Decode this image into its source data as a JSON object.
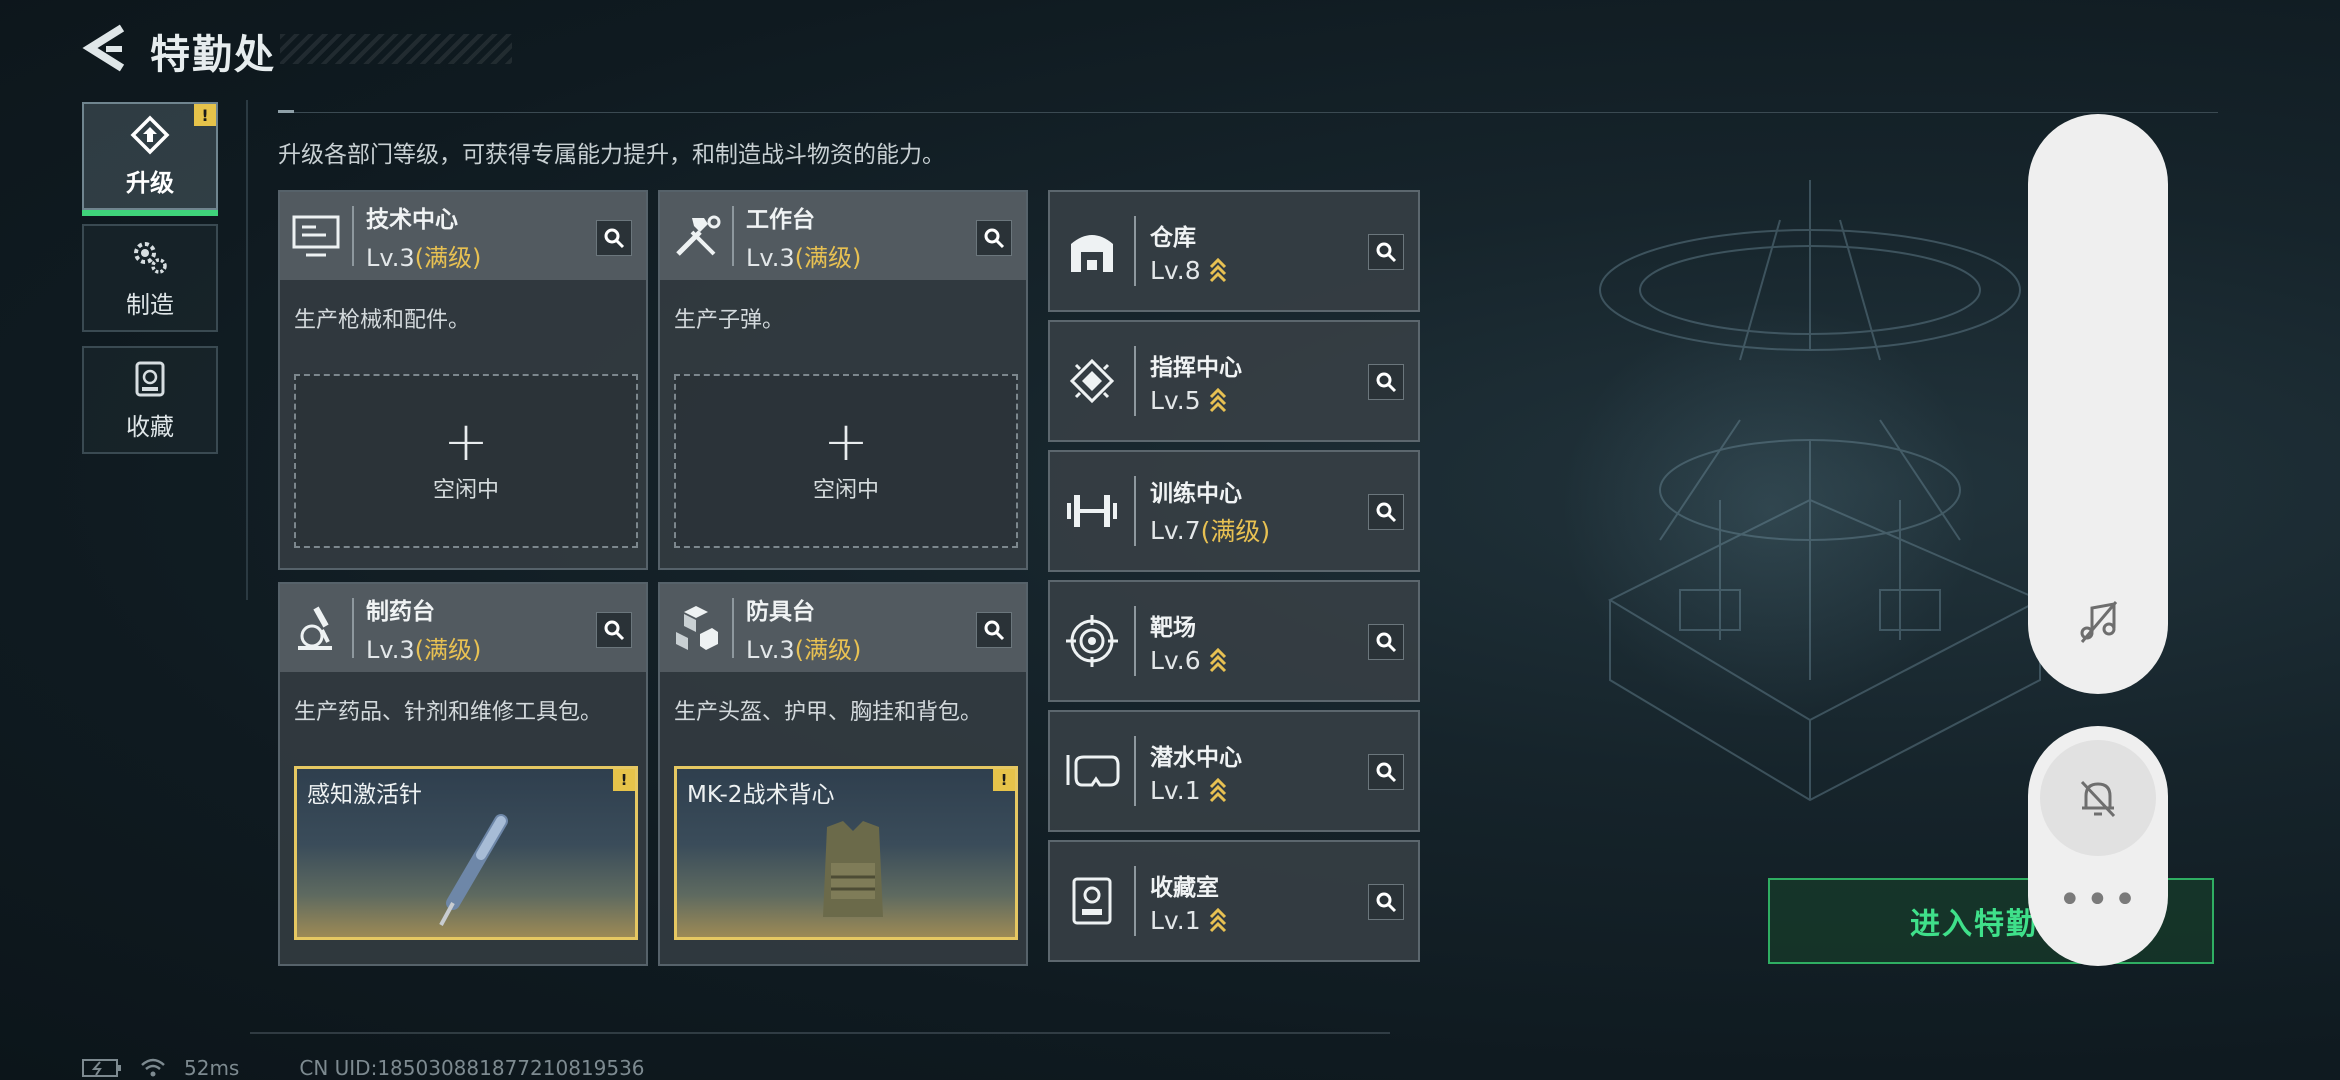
{
  "header": {
    "title": "特勤处"
  },
  "nav": [
    {
      "label": "升级",
      "icon": "upgrade-icon",
      "active": true,
      "badge": "!"
    },
    {
      "label": "制造",
      "icon": "gears-icon",
      "active": false
    },
    {
      "label": "收藏",
      "icon": "collection-icon",
      "active": false
    }
  ],
  "description": "升级各部门等级，可获得专属能力提升，和制造战斗物资的能力。",
  "big_cards": [
    {
      "name": "技术中心",
      "level": "Lv.3",
      "max_label": "(满级)",
      "desc": "生产枪械和配件。",
      "slot": {
        "state": "idle",
        "text": "空闲中",
        "plus": "+"
      }
    },
    {
      "name": "工作台",
      "level": "Lv.3",
      "max_label": "(满级)",
      "desc": "生产子弹。",
      "slot": {
        "state": "idle",
        "text": "空闲中",
        "plus": "+"
      }
    },
    {
      "name": "制药台",
      "level": "Lv.3",
      "max_label": "(满级)",
      "desc": "生产药品、针剂和维修工具包。",
      "slot": {
        "state": "crafting",
        "item": "感知激活针",
        "badge": "!"
      }
    },
    {
      "name": "防具台",
      "level": "Lv.3",
      "max_label": "(满级)",
      "desc": "生产头盔、护甲、胸挂和背包。",
      "slot": {
        "state": "crafting",
        "item": "MK-2战术背心",
        "badge": "!"
      }
    }
  ],
  "small_cards": [
    {
      "name": "仓库",
      "level": "Lv.8",
      "max_label": "",
      "upgradable": true
    },
    {
      "name": "指挥中心",
      "level": "Lv.5",
      "max_label": "",
      "upgradable": true
    },
    {
      "name": "训练中心",
      "level": "Lv.7",
      "max_label": "(满级)",
      "upgradable": false
    },
    {
      "name": "靶场",
      "level": "Lv.6",
      "max_label": "",
      "upgradable": true
    },
    {
      "name": "潜水中心",
      "level": "Lv.1",
      "max_label": "",
      "upgradable": true
    },
    {
      "name": "收藏室",
      "level": "Lv.1",
      "max_label": "",
      "upgradable": true
    }
  ],
  "enter_button": {
    "label": "进入特勤"
  },
  "side_panel": {
    "more": "•••"
  },
  "footer": {
    "ping": "52ms",
    "uid": "CN UID:1850308818772108195​36"
  },
  "colors": {
    "accent_green": "#3fd37a",
    "max_gold": "#e8c152",
    "badge_yellow": "#e6c34a"
  }
}
